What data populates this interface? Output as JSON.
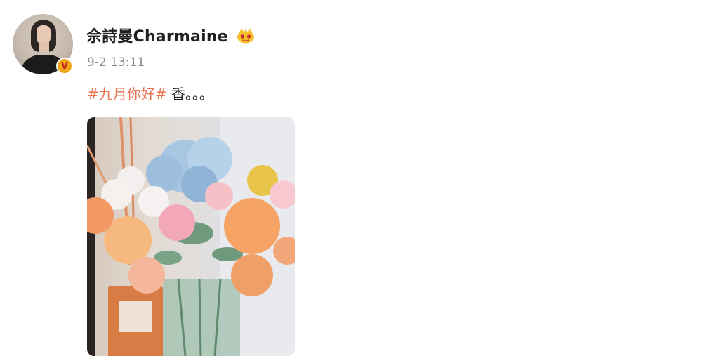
{
  "post": {
    "author": {
      "name": "佘詩曼Charmaine",
      "verified_badge": "V"
    },
    "timestamp": "9-2 13:11",
    "hashtag": "#九月你好#",
    "text": " 香。。。",
    "image_alt": "flowers in vase"
  },
  "colors": {
    "hashtag": "#eb7350",
    "timestamp": "#888888",
    "badge": "#f3a617"
  },
  "icons": {
    "verified": "verified-v-icon",
    "member": "crown-member-icon"
  }
}
